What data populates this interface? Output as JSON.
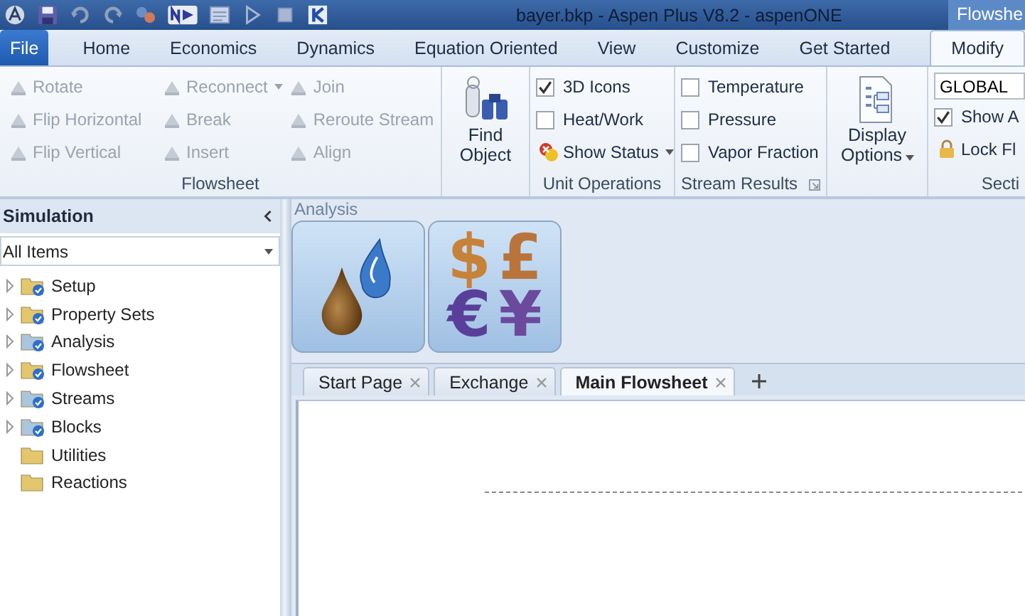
{
  "window": {
    "title": "bayer.bkp - Aspen Plus V8.2 - aspenONE",
    "context_label": "Flowshe"
  },
  "ribbon_tabs": [
    {
      "label": "File",
      "kind": "file",
      "selected": false
    },
    {
      "label": "Home",
      "kind": "tab",
      "selected": false
    },
    {
      "label": "Economics",
      "kind": "tab",
      "selected": false
    },
    {
      "label": "Dynamics",
      "kind": "tab",
      "selected": false
    },
    {
      "label": "Equation Oriented",
      "kind": "tab",
      "selected": false
    },
    {
      "label": "View",
      "kind": "tab",
      "selected": false
    },
    {
      "label": "Customize",
      "kind": "tab",
      "selected": false
    },
    {
      "label": "Get Started",
      "kind": "tab",
      "selected": false
    },
    {
      "label": "Modify",
      "kind": "tab",
      "selected": true
    }
  ],
  "ribbon": {
    "flowsheet": {
      "label": "Flowsheet",
      "columns": [
        [
          {
            "label": "Rotate",
            "disabled": true
          },
          {
            "label": "Flip Horizontal",
            "disabled": true
          },
          {
            "label": "Flip Vertical",
            "disabled": true
          }
        ],
        [
          {
            "label": "Reconnect",
            "disabled": true,
            "dropdown": true
          },
          {
            "label": "Break",
            "disabled": true
          },
          {
            "label": "Insert",
            "disabled": true
          }
        ],
        [
          {
            "label": "Join",
            "disabled": true
          },
          {
            "label": "Reroute Stream",
            "disabled": true
          },
          {
            "label": "Align",
            "disabled": true
          }
        ]
      ]
    },
    "find_object": {
      "label": "Find Object"
    },
    "unit_operations": {
      "label": "Unit Operations",
      "items": [
        {
          "kind": "checkbox",
          "label": "3D Icons",
          "checked": true
        },
        {
          "kind": "checkbox",
          "label": "Heat/Work",
          "checked": false
        },
        {
          "kind": "menu",
          "label": "Show Status"
        }
      ]
    },
    "stream_results": {
      "label": "Stream Results",
      "items": [
        {
          "kind": "checkbox",
          "label": "Temperature",
          "checked": false
        },
        {
          "kind": "checkbox",
          "label": "Pressure",
          "checked": false
        },
        {
          "kind": "checkbox",
          "label": "Vapor Fraction",
          "checked": false
        }
      ]
    },
    "display_options": {
      "label": "Display Options"
    },
    "section": {
      "label": "Secti",
      "value": "GLOBAL",
      "items": [
        {
          "kind": "checkbox",
          "label": "Show A",
          "checked": true
        },
        {
          "kind": "lock",
          "label": "Lock Fl"
        }
      ]
    }
  },
  "sidebar": {
    "title": "Simulation",
    "filter": "All Items",
    "tree": [
      {
        "label": "Setup",
        "expandable": true,
        "checked": true,
        "color": "#e4c66c"
      },
      {
        "label": "Property Sets",
        "expandable": true,
        "checked": true,
        "color": "#e4c66c"
      },
      {
        "label": "Analysis",
        "expandable": true,
        "checked": true,
        "color": "#a9c6de"
      },
      {
        "label": "Flowsheet",
        "expandable": true,
        "checked": true,
        "color": "#e4c66c"
      },
      {
        "label": "Streams",
        "expandable": true,
        "checked": true,
        "color": "#a9c6de"
      },
      {
        "label": "Blocks",
        "expandable": true,
        "checked": true,
        "color": "#a9c6de"
      },
      {
        "label": "Utilities",
        "expandable": false,
        "checked": false,
        "color": "#e4c66c"
      },
      {
        "label": "Reactions",
        "expandable": false,
        "checked": false,
        "color": "#e4c66c"
      }
    ]
  },
  "analysis": {
    "title": "Analysis",
    "buttons": [
      {
        "kind": "property"
      },
      {
        "kind": "economics",
        "symbols": [
          "$",
          "£",
          "€",
          "¥"
        ]
      }
    ]
  },
  "document_tabs": [
    {
      "label": "Start Page",
      "selected": false
    },
    {
      "label": "Exchange",
      "selected": false
    },
    {
      "label": "Main Flowsheet",
      "selected": true
    }
  ]
}
